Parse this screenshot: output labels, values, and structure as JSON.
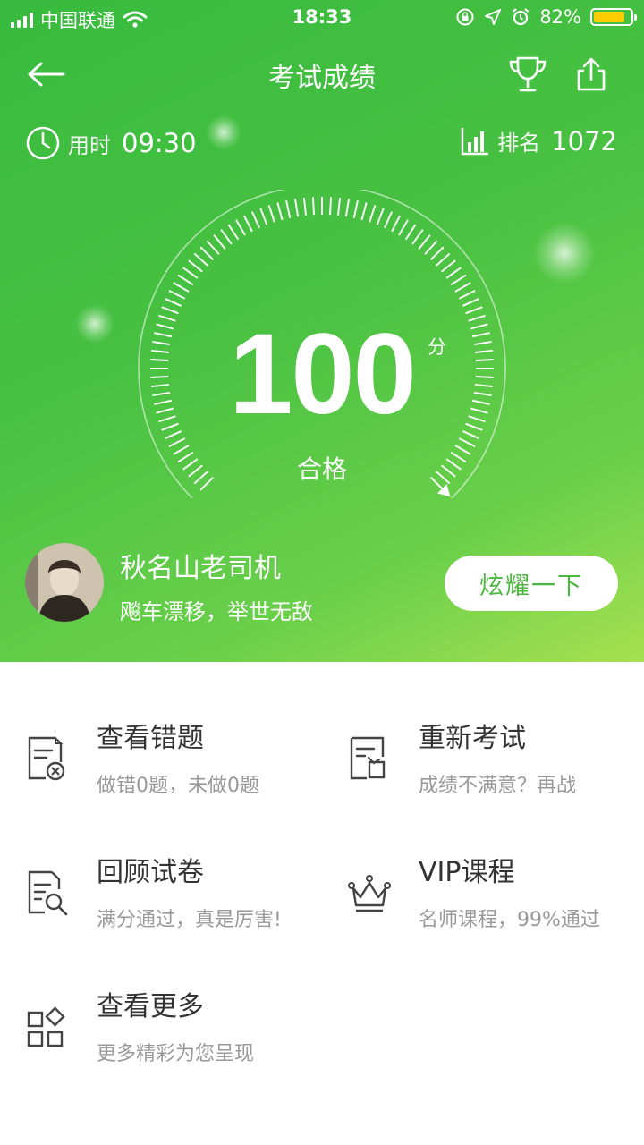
{
  "status_bar": {
    "carrier": "中国联通",
    "time": "18:33",
    "battery_percent": "82%",
    "icons": [
      "signal-icon",
      "wifi-icon",
      "lock-rotation-icon",
      "location-icon",
      "alarm-icon",
      "battery-icon"
    ],
    "battery_level": 0.82
  },
  "header": {
    "title": "考试成绩",
    "back_icon": "arrow-left-icon",
    "trophy_icon": "trophy-icon",
    "share_icon": "share-icon"
  },
  "stats": {
    "time_label": "用时",
    "time_value": "09:30",
    "rank_label": "排名",
    "rank_value": "1072"
  },
  "result": {
    "score": "100",
    "unit": "分",
    "status": "合格",
    "gauge_fraction": 1.0
  },
  "user": {
    "name": "秋名山老司机",
    "motto": "飚车漂移，举世无敌",
    "show_button": "炫耀一下"
  },
  "menu": [
    {
      "title": "查看错题",
      "subtitle": "做错0题，未做0题",
      "icon": "wrong-answers-icon"
    },
    {
      "title": "重新考试",
      "subtitle": "成绩不满意？再战",
      "icon": "retake-exam-icon"
    },
    {
      "title": "回顾试卷",
      "subtitle": "满分通过，真是厉害!",
      "icon": "review-paper-icon"
    },
    {
      "title": "VIP课程",
      "subtitle": "名师课程，99%通过",
      "icon": "crown-icon"
    },
    {
      "title": "查看更多",
      "subtitle": "更多精彩为您呈现",
      "icon": "more-apps-icon"
    }
  ],
  "colors": {
    "brand_green": "#49c142",
    "button_text_green": "#4db640",
    "title_text": "#333333",
    "subtitle_text": "#999999"
  }
}
